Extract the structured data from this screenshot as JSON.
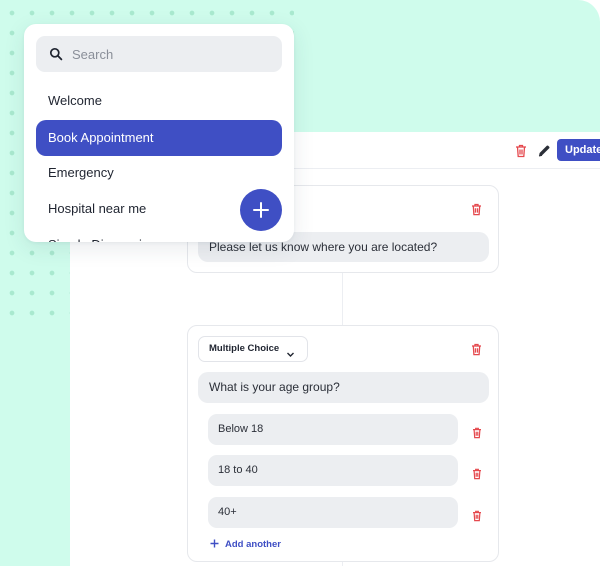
{
  "colors": {
    "accent": "#3f4fc4",
    "mint_background": "#cffcec",
    "danger_icon": "#e5484d",
    "bubble_gray": "#eceef1"
  },
  "sidebar": {
    "search": {
      "placeholder": "Search",
      "value": "",
      "icon": "search-icon"
    },
    "items": [
      {
        "label": "Welcome",
        "active": false
      },
      {
        "label": "Book Appointment",
        "active": true
      },
      {
        "label": "Emergency",
        "active": false
      },
      {
        "label": "Hospital near me",
        "active": false
      },
      {
        "label": "Simple Diagnosis",
        "active": false
      }
    ],
    "fab": {
      "icon": "plus-icon"
    }
  },
  "toolbar": {
    "delete_icon": "trash-icon",
    "edit_icon": "pencil-icon",
    "update_label": "Update"
  },
  "cards": [
    {
      "question": "Please let us know where you are located?",
      "delete_icon": "trash-icon"
    },
    {
      "type_label": "Multiple Choice",
      "type_icon": "chevron-down-icon",
      "question": "What is your age group?",
      "options": [
        {
          "label": "Below 18"
        },
        {
          "label": "18 to 40"
        },
        {
          "label": "40+"
        }
      ],
      "add_label": "Add another",
      "delete_icon": "trash-icon"
    }
  ]
}
